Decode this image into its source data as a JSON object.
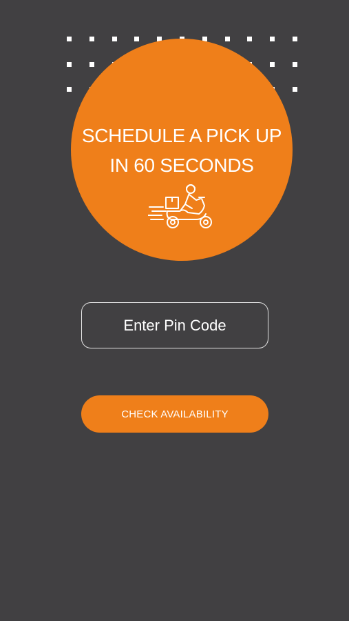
{
  "hero": {
    "title_line1": "SCHEDULE A PICK UP",
    "title_line2": "IN 60 SECONDS",
    "icon": "delivery-scooter-icon"
  },
  "pin_input": {
    "placeholder": "Enter Pin Code",
    "value": ""
  },
  "check_button": {
    "label": "CHECK AVAILABILITY"
  },
  "colors": {
    "background": "#414042",
    "accent": "#ef7f1a",
    "text": "#ffffff",
    "input_border": "#e6e6e6"
  }
}
